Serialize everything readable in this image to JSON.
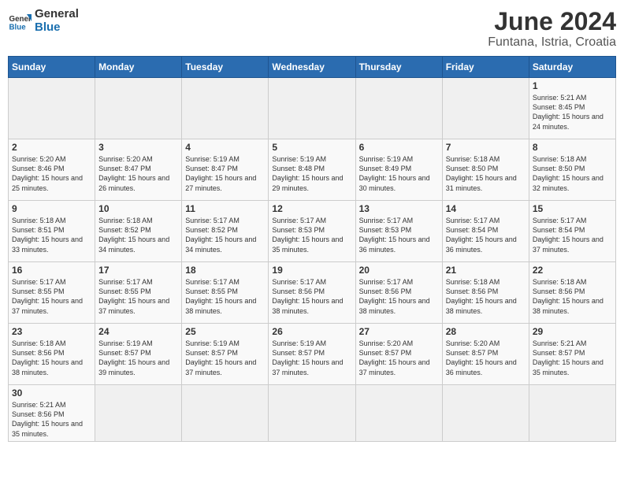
{
  "header": {
    "title": "June 2024",
    "subtitle": "Funtana, Istria, Croatia",
    "logo_general": "General",
    "logo_blue": "Blue"
  },
  "calendar": {
    "days_of_week": [
      "Sunday",
      "Monday",
      "Tuesday",
      "Wednesday",
      "Thursday",
      "Friday",
      "Saturday"
    ],
    "weeks": [
      [
        {
          "day": "",
          "info": ""
        },
        {
          "day": "",
          "info": ""
        },
        {
          "day": "",
          "info": ""
        },
        {
          "day": "",
          "info": ""
        },
        {
          "day": "",
          "info": ""
        },
        {
          "day": "",
          "info": ""
        },
        {
          "day": "1",
          "info": "Sunrise: 5:21 AM\nSunset: 8:45 PM\nDaylight: 15 hours and 24 minutes."
        }
      ],
      [
        {
          "day": "2",
          "info": "Sunrise: 5:20 AM\nSunset: 8:46 PM\nDaylight: 15 hours and 25 minutes."
        },
        {
          "day": "3",
          "info": "Sunrise: 5:20 AM\nSunset: 8:47 PM\nDaylight: 15 hours and 26 minutes."
        },
        {
          "day": "4",
          "info": "Sunrise: 5:19 AM\nSunset: 8:47 PM\nDaylight: 15 hours and 27 minutes."
        },
        {
          "day": "5",
          "info": "Sunrise: 5:19 AM\nSunset: 8:48 PM\nDaylight: 15 hours and 29 minutes."
        },
        {
          "day": "6",
          "info": "Sunrise: 5:19 AM\nSunset: 8:49 PM\nDaylight: 15 hours and 30 minutes."
        },
        {
          "day": "7",
          "info": "Sunrise: 5:18 AM\nSunset: 8:50 PM\nDaylight: 15 hours and 31 minutes."
        },
        {
          "day": "8",
          "info": "Sunrise: 5:18 AM\nSunset: 8:50 PM\nDaylight: 15 hours and 32 minutes."
        }
      ],
      [
        {
          "day": "9",
          "info": "Sunrise: 5:18 AM\nSunset: 8:51 PM\nDaylight: 15 hours and 33 minutes."
        },
        {
          "day": "10",
          "info": "Sunrise: 5:18 AM\nSunset: 8:52 PM\nDaylight: 15 hours and 34 minutes."
        },
        {
          "day": "11",
          "info": "Sunrise: 5:17 AM\nSunset: 8:52 PM\nDaylight: 15 hours and 34 minutes."
        },
        {
          "day": "12",
          "info": "Sunrise: 5:17 AM\nSunset: 8:53 PM\nDaylight: 15 hours and 35 minutes."
        },
        {
          "day": "13",
          "info": "Sunrise: 5:17 AM\nSunset: 8:53 PM\nDaylight: 15 hours and 36 minutes."
        },
        {
          "day": "14",
          "info": "Sunrise: 5:17 AM\nSunset: 8:54 PM\nDaylight: 15 hours and 36 minutes."
        },
        {
          "day": "15",
          "info": "Sunrise: 5:17 AM\nSunset: 8:54 PM\nDaylight: 15 hours and 37 minutes."
        }
      ],
      [
        {
          "day": "16",
          "info": "Sunrise: 5:17 AM\nSunset: 8:55 PM\nDaylight: 15 hours and 37 minutes."
        },
        {
          "day": "17",
          "info": "Sunrise: 5:17 AM\nSunset: 8:55 PM\nDaylight: 15 hours and 37 minutes."
        },
        {
          "day": "18",
          "info": "Sunrise: 5:17 AM\nSunset: 8:55 PM\nDaylight: 15 hours and 38 minutes."
        },
        {
          "day": "19",
          "info": "Sunrise: 5:17 AM\nSunset: 8:56 PM\nDaylight: 15 hours and 38 minutes."
        },
        {
          "day": "20",
          "info": "Sunrise: 5:17 AM\nSunset: 8:56 PM\nDaylight: 15 hours and 38 minutes."
        },
        {
          "day": "21",
          "info": "Sunrise: 5:18 AM\nSunset: 8:56 PM\nDaylight: 15 hours and 38 minutes."
        },
        {
          "day": "22",
          "info": "Sunrise: 5:18 AM\nSunset: 8:56 PM\nDaylight: 15 hours and 38 minutes."
        }
      ],
      [
        {
          "day": "23",
          "info": "Sunrise: 5:18 AM\nSunset: 8:56 PM\nDaylight: 15 hours and 38 minutes."
        },
        {
          "day": "24",
          "info": "Sunrise: 5:19 AM\nSunset: 8:57 PM\nDaylight: 15 hours and 39 minutes."
        },
        {
          "day": "25",
          "info": "Sunrise: 5:19 AM\nSunset: 8:57 PM\nDaylight: 15 hours and 37 minutes."
        },
        {
          "day": "26",
          "info": "Sunrise: 5:19 AM\nSunset: 8:57 PM\nDaylight: 15 hours and 37 minutes."
        },
        {
          "day": "27",
          "info": "Sunrise: 5:20 AM\nSunset: 8:57 PM\nDaylight: 15 hours and 37 minutes."
        },
        {
          "day": "28",
          "info": "Sunrise: 5:20 AM\nSunset: 8:57 PM\nDaylight: 15 hours and 36 minutes."
        },
        {
          "day": "29",
          "info": "Sunrise: 5:21 AM\nSunset: 8:57 PM\nDaylight: 15 hours and 35 minutes."
        }
      ],
      [
        {
          "day": "30",
          "info": "Sunrise: 5:21 AM\nSunset: 8:56 PM\nDaylight: 15 hours and 35 minutes."
        },
        {
          "day": "",
          "info": ""
        },
        {
          "day": "",
          "info": ""
        },
        {
          "day": "",
          "info": ""
        },
        {
          "day": "",
          "info": ""
        },
        {
          "day": "",
          "info": ""
        },
        {
          "day": "",
          "info": ""
        }
      ]
    ]
  }
}
